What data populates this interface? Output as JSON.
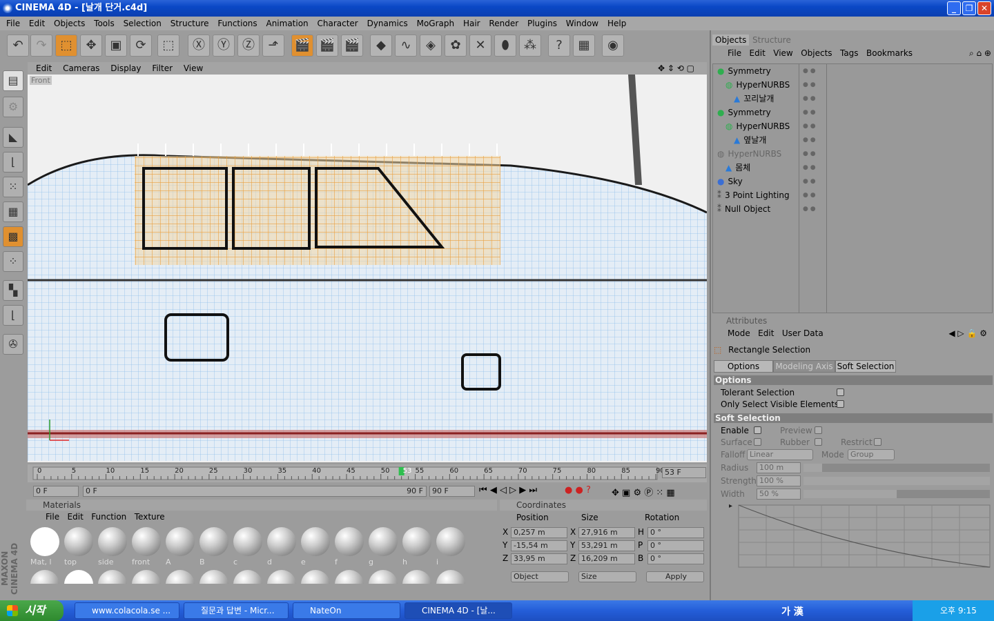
{
  "window": {
    "title": "CINEMA 4D - [날개 단거.c4d]"
  },
  "menu": [
    "File",
    "Edit",
    "Objects",
    "Tools",
    "Selection",
    "Structure",
    "Functions",
    "Animation",
    "Character",
    "Dynamics",
    "MoGraph",
    "Hair",
    "Render",
    "Plugins",
    "Window",
    "Help"
  ],
  "viewport": {
    "menu": [
      "Edit",
      "Cameras",
      "Display",
      "Filter",
      "View"
    ],
    "label": "Front"
  },
  "timeline": {
    "ticks": [
      "0",
      "5",
      "10",
      "15",
      "20",
      "25",
      "30",
      "35",
      "40",
      "45",
      "50",
      "55",
      "60",
      "65",
      "70",
      "75",
      "80",
      "85",
      "90"
    ],
    "current_frame": 53,
    "current_label": "53",
    "frame_field": "53 F",
    "start": "0 F",
    "range_start": "0 F",
    "range_end": "90 F",
    "end": "90 F"
  },
  "materials": {
    "title": "Materials",
    "menu": [
      "File",
      "Edit",
      "Function",
      "Texture"
    ],
    "row1": [
      "Mat, l",
      "top",
      "side",
      "front",
      "A",
      "B",
      "c",
      "d",
      "e",
      "f",
      "g",
      "h",
      "i"
    ],
    "row2_count": 13
  },
  "coordinates": {
    "title": "Coordinates",
    "headers": [
      "Position",
      "Size",
      "Rotation"
    ],
    "rows": [
      {
        "axis": "X",
        "pos": "0,257 m",
        "saxis": "X",
        "size": "27,916 m",
        "raxis": "H",
        "rot": "0 °"
      },
      {
        "axis": "Y",
        "pos": "-15,54 m",
        "saxis": "Y",
        "size": "53,291 m",
        "raxis": "P",
        "rot": "0 °"
      },
      {
        "axis": "Z",
        "pos": "33,95 m",
        "saxis": "Z",
        "size": "16,209 m",
        "raxis": "B",
        "rot": "0 °"
      }
    ],
    "mode": "Object",
    "size_mode": "Size",
    "apply": "Apply"
  },
  "objects": {
    "tabs": [
      "Objects",
      "Structure"
    ],
    "menu": [
      "File",
      "Edit",
      "View",
      "Objects",
      "Tags",
      "Bookmarks"
    ],
    "tree": [
      "Symmetry",
      "HyperNURBS",
      "꼬리날개",
      "Symmetry",
      "HyperNURBS",
      "옆날개",
      "HyperNURBS",
      "몸체",
      "Sky",
      "3 Point Lighting",
      "Null Object"
    ]
  },
  "attributes": {
    "title": "Attributes",
    "menu": [
      "Mode",
      "Edit",
      "User Data"
    ],
    "tool": "Rectangle Selection",
    "tabs": [
      "Options",
      "Modeling Axis",
      "Soft Selection"
    ],
    "options_head": "Options",
    "tolerant": "Tolerant Selection",
    "only_visible": "Only Select Visible Elements",
    "soft_head": "Soft Selection",
    "enable": "Enable",
    "preview": "Preview",
    "surface": "Surface",
    "rubber": "Rubber",
    "restrict": "Restrict",
    "falloff_label": "Falloff",
    "falloff": "Linear",
    "mode_label": "Mode",
    "mode": "Group",
    "radius_label": "Radius",
    "radius": "100 m",
    "strength_label": "Strength",
    "strength": "100 %",
    "width_label": "Width",
    "width": "50 %"
  },
  "taskbar": {
    "start": "시작",
    "tasks": [
      "www.colacola.se ...",
      "질문과 답변 - Micr...",
      "NateOn",
      "CINEMA 4D - [날..."
    ],
    "ime": "가 漢",
    "time": "오후 9:15"
  },
  "logo": "MAXON CINEMA 4D",
  "colors": {
    "title": "#0a48c6",
    "panel": "#9c9c9c",
    "selection": "#e8a040",
    "wire": "#7fb5e8",
    "taskbar": "#245ed8",
    "start": "#2e8a2e"
  }
}
